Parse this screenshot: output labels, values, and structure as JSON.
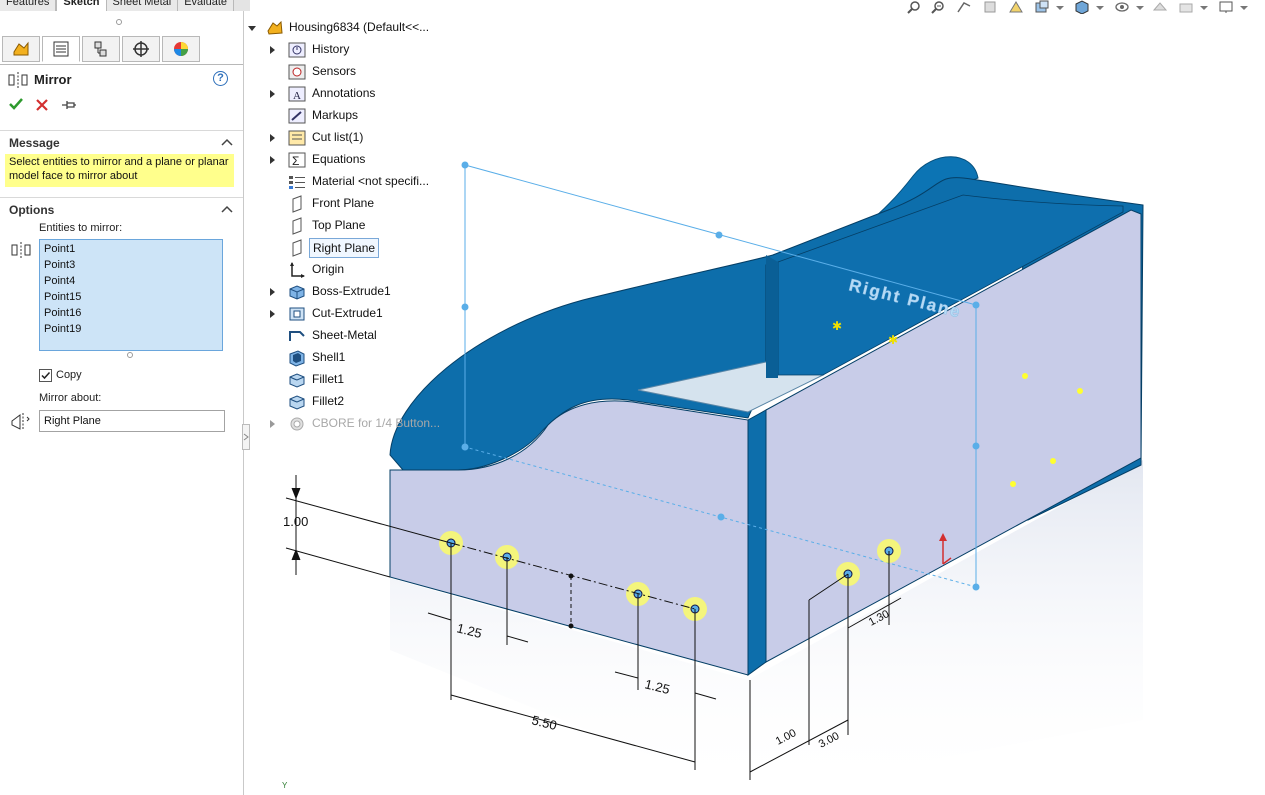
{
  "tabs": [
    "Features",
    "Sketch",
    "Sheet Metal",
    "Evaluate"
  ],
  "active_tab": "Sketch",
  "property_manager": {
    "title": "Mirror",
    "message_header": "Message",
    "message_text": "Select entities to mirror and a plane or planar model face to mirror about",
    "options_header": "Options",
    "entities_label": "Entities to mirror:",
    "entities": [
      "Point1",
      "Point3",
      "Point4",
      "Point15",
      "Point16",
      "Point19"
    ],
    "copy_label": "Copy",
    "copy_checked": true,
    "mirror_about_label": "Mirror about:",
    "mirror_about_value": "Right Plane"
  },
  "feature_tree": {
    "root": "Housing6834  (Default<<...",
    "items": [
      {
        "label": "History",
        "icon": "history-icon",
        "expandable": true
      },
      {
        "label": "Sensors",
        "icon": "sensors-icon",
        "expandable": false
      },
      {
        "label": "Annotations",
        "icon": "annotations-icon",
        "expandable": true
      },
      {
        "label": "Markups",
        "icon": "markups-icon",
        "expandable": false
      },
      {
        "label": "Cut list(1)",
        "icon": "cut-list-icon",
        "expandable": true
      },
      {
        "label": "Equations",
        "icon": "equations-icon",
        "expandable": true
      },
      {
        "label": "Material <not specifi...",
        "icon": "material-icon",
        "expandable": false
      },
      {
        "label": "Front Plane",
        "icon": "plane-icon",
        "expandable": false
      },
      {
        "label": "Top Plane",
        "icon": "plane-icon",
        "expandable": false
      },
      {
        "label": "Right Plane",
        "icon": "plane-icon",
        "expandable": false,
        "selected": true
      },
      {
        "label": "Origin",
        "icon": "origin-icon",
        "expandable": false
      },
      {
        "label": "Boss-Extrude1",
        "icon": "boss-extrude-icon",
        "expandable": true
      },
      {
        "label": "Cut-Extrude1",
        "icon": "cut-extrude-icon",
        "expandable": true
      },
      {
        "label": "Sheet-Metal",
        "icon": "sheet-metal-icon",
        "expandable": false
      },
      {
        "label": "Shell1",
        "icon": "shell-icon",
        "expandable": false
      },
      {
        "label": "Fillet1",
        "icon": "fillet-icon",
        "expandable": false
      },
      {
        "label": "Fillet2",
        "icon": "fillet-icon",
        "expandable": false
      },
      {
        "label": "CBORE for 1/4 Button...",
        "icon": "hole-wizard-icon",
        "expandable": true,
        "dimmed": true
      }
    ]
  },
  "graphics": {
    "plane_label": "Right Plane",
    "dimensions": [
      "1.00",
      "1.25",
      "1.25",
      "5.50",
      "1.30",
      "1.00",
      "3.00"
    ],
    "triad_label": "Y"
  },
  "colors": {
    "part_blue": "#0a6aa8",
    "face_lavender": "#c8cce8",
    "selection_yellow": "#ffff8c",
    "list_blue": "#cde4f7",
    "plane_outline": "#5aaee8"
  }
}
